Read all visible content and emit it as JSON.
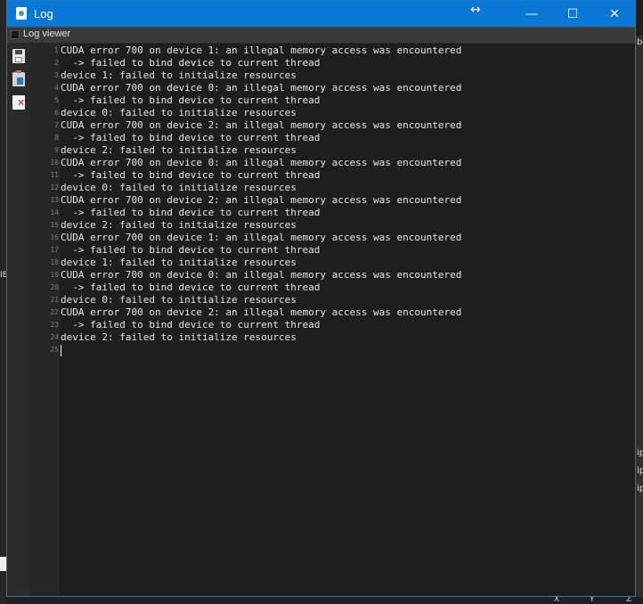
{
  "window": {
    "title": "Log",
    "controls": {
      "minimize": "—",
      "maximize": "☐",
      "close": "✕",
      "resize": "↔"
    }
  },
  "panel": {
    "label": "Log viewer"
  },
  "toolbar": {
    "items": [
      {
        "icon": "save-icon"
      },
      {
        "icon": "copy-icon"
      },
      {
        "icon": "clear-icon"
      }
    ]
  },
  "log": {
    "lines": [
      "CUDA error 700 on device 1: an illegal memory access was encountered",
      "  -> failed to bind device to current thread",
      "device 1: failed to initialize resources",
      "CUDA error 700 on device 0: an illegal memory access was encountered",
      "  -> failed to bind device to current thread",
      "device 0: failed to initialize resources",
      "CUDA error 700 on device 2: an illegal memory access was encountered",
      "  -> failed to bind device to current thread",
      "device 2: failed to initialize resources",
      "CUDA error 700 on device 0: an illegal memory access was encountered",
      "  -> failed to bind device to current thread",
      "device 0: failed to initialize resources",
      "CUDA error 700 on device 2: an illegal memory access was encountered",
      "  -> failed to bind device to current thread",
      "device 2: failed to initialize resources",
      "CUDA error 700 on device 1: an illegal memory access was encountered",
      "  -> failed to bind device to current thread",
      "device 1: failed to initialize resources",
      "CUDA error 700 on device 0: an illegal memory access was encountered",
      "  -> failed to bind device to current thread",
      "device 0: failed to initialize resources",
      "CUDA error 700 on device 2: an illegal memory access was encountered",
      "  -> failed to bind device to current thread",
      "device 2: failed to initialize resources",
      ""
    ],
    "line_numbers": [
      "1",
      "2",
      "3",
      "4",
      "5",
      "6",
      "7",
      "8",
      "9",
      "10",
      "11",
      "12",
      "13",
      "14",
      "15",
      "16",
      "17",
      "18",
      "19",
      "20",
      "21",
      "22",
      "23",
      "24",
      "25"
    ]
  },
  "background": {
    "fragments": [
      "b",
      "IE",
      "ip",
      "ip",
      "ip"
    ],
    "axis": [
      "X",
      "Y",
      "Z"
    ]
  },
  "colors": {
    "titlebar": "#0a78d7",
    "editor_bg": "#1e1e1e",
    "text": "#e4e4e4"
  }
}
